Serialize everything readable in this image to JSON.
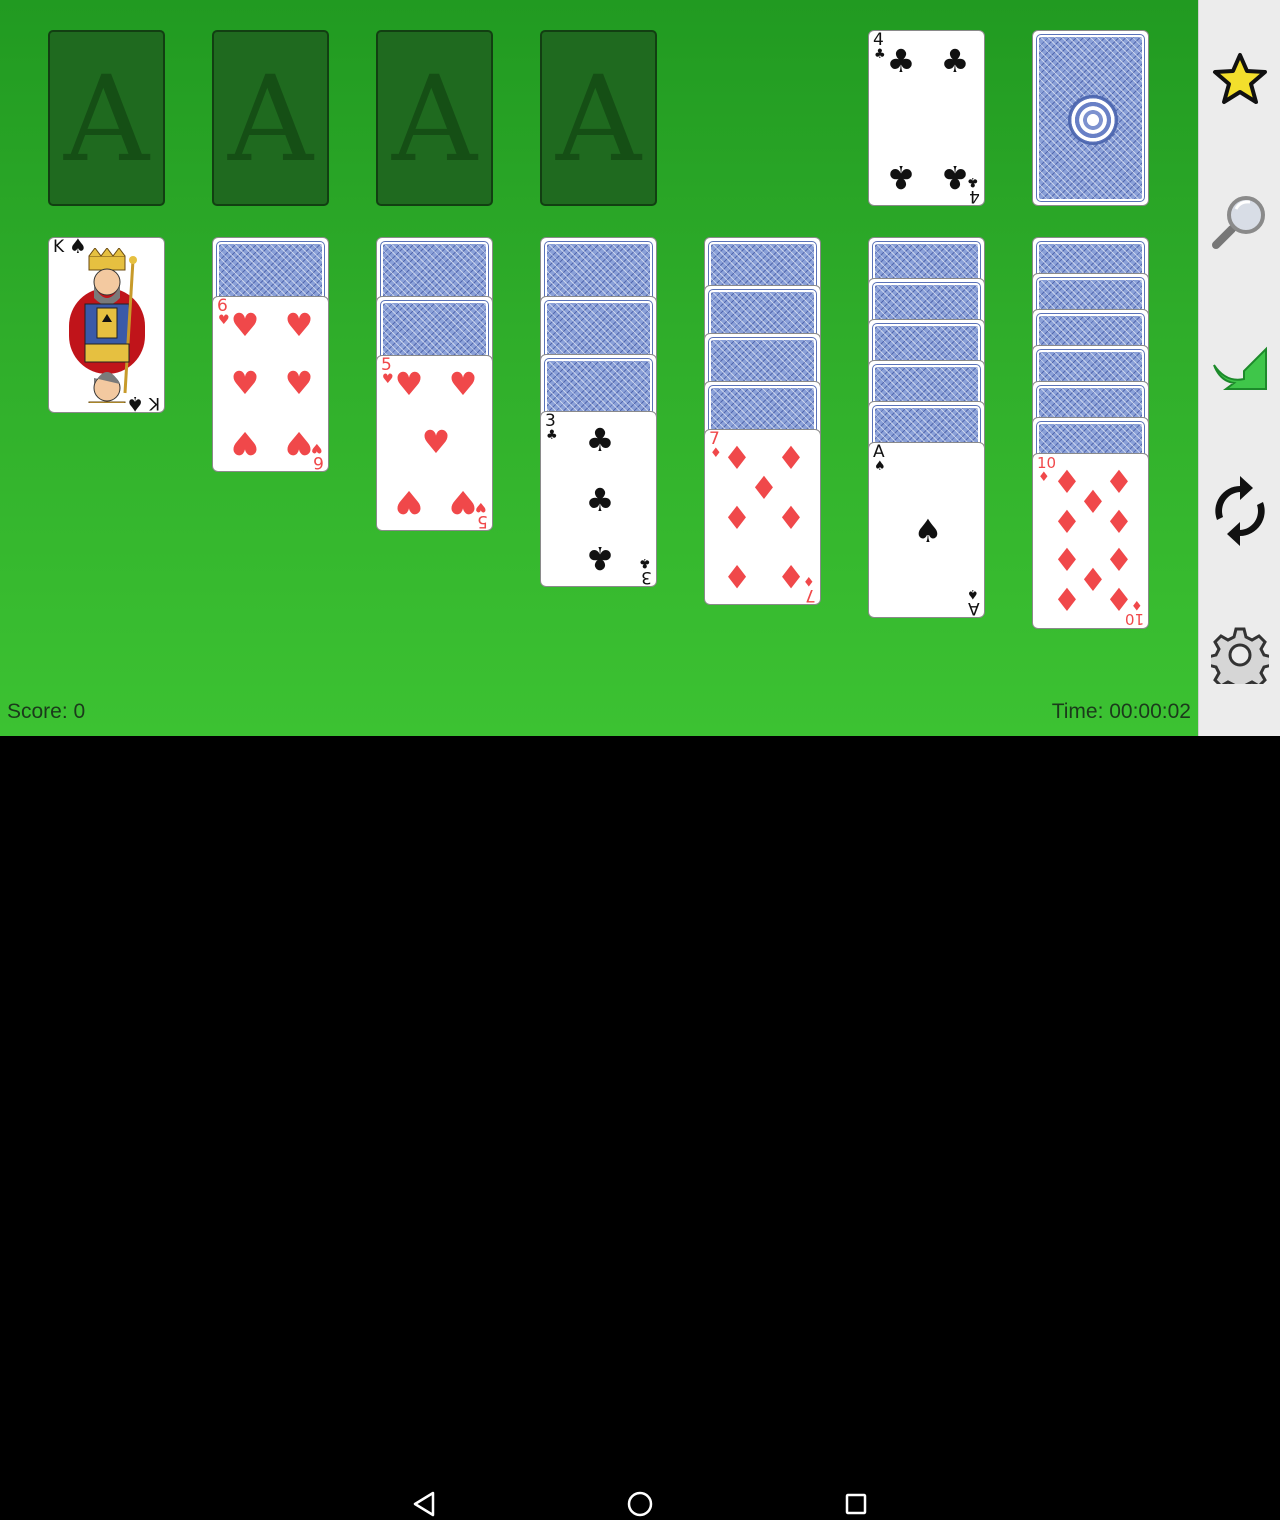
{
  "foundations": [
    {
      "label": "A"
    },
    {
      "label": "A"
    },
    {
      "label": "A"
    },
    {
      "label": "A"
    }
  ],
  "waste": {
    "rank": "4",
    "suit": "♣",
    "color": "black"
  },
  "stock": {
    "face": "down"
  },
  "tableau": [
    {
      "hidden": 0,
      "face_up": {
        "rank": "K",
        "suit": "♠",
        "color": "black"
      }
    },
    {
      "hidden": 1,
      "face_up": {
        "rank": "6",
        "suit": "♥",
        "color": "red"
      }
    },
    {
      "hidden": 2,
      "face_up": {
        "rank": "5",
        "suit": "♥",
        "color": "red"
      }
    },
    {
      "hidden": 3,
      "face_up": {
        "rank": "3",
        "suit": "♣",
        "color": "black"
      }
    },
    {
      "hidden": 4,
      "face_up": {
        "rank": "7",
        "suit": "♦",
        "color": "red"
      }
    },
    {
      "hidden": 5,
      "face_up": {
        "rank": "A",
        "suit": "♠",
        "color": "black"
      }
    },
    {
      "hidden": 6,
      "face_up": {
        "rank": "10",
        "suit": "♦",
        "color": "red"
      }
    }
  ],
  "status": {
    "score_text": "Score: 0",
    "time_text": "Time: 00:00:02"
  },
  "sidebar": {
    "items": [
      {
        "name": "star-icon"
      },
      {
        "name": "search-icon"
      },
      {
        "name": "redo-arrow-icon"
      },
      {
        "name": "refresh-icon"
      },
      {
        "name": "gear-icon"
      }
    ]
  },
  "colors": {
    "felt_top": "#219a21",
    "felt_bottom": "#3cc232",
    "red_suit": "#f0484a",
    "black_suit": "#111111",
    "card_back": "#8aa0d8",
    "sidebar_bg": "#ececec"
  },
  "navbar": {
    "items": [
      {
        "name": "back-icon"
      },
      {
        "name": "home-icon"
      },
      {
        "name": "recents-icon"
      }
    ]
  }
}
